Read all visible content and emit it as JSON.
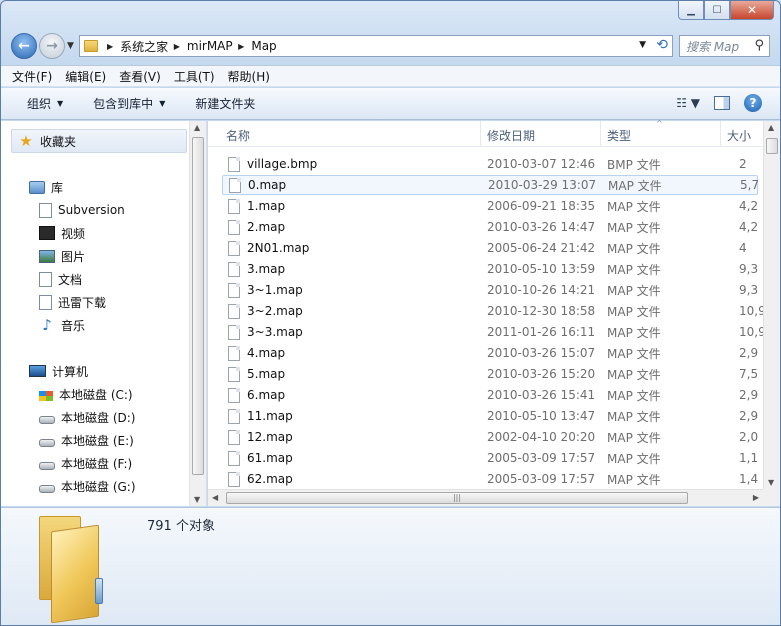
{
  "window": {
    "caption_buttons": [
      "minimize",
      "maximize",
      "close"
    ]
  },
  "address": {
    "crumbs": [
      "系统之家",
      "mirMAP",
      "Map"
    ]
  },
  "search": {
    "placeholder": "搜索 Map"
  },
  "menu": [
    "文件(F)",
    "编辑(E)",
    "查看(V)",
    "工具(T)",
    "帮助(H)"
  ],
  "commands": {
    "organize": "组织",
    "include_library": "包含到库中",
    "new_folder": "新建文件夹"
  },
  "nav": {
    "favorites": "收藏夹",
    "libraries": "库",
    "library_items": [
      "Subversion",
      "视频",
      "图片",
      "文档",
      "迅雷下载",
      "音乐"
    ],
    "computer": "计算机",
    "drives": [
      "本地磁盘 (C:)",
      "本地磁盘 (D:)",
      "本地磁盘 (E:)",
      "本地磁盘 (F:)",
      "本地磁盘 (G:)"
    ]
  },
  "columns": {
    "name": "名称",
    "modified": "修改日期",
    "type": "类型",
    "size": "大小"
  },
  "files": [
    {
      "name": "village.bmp",
      "modified": "2010-03-07 12:46",
      "type": "BMP 文件",
      "size": "2"
    },
    {
      "name": "0.map",
      "modified": "2010-03-29 13:07",
      "type": "MAP 文件",
      "size": "5,7"
    },
    {
      "name": "1.map",
      "modified": "2006-09-21 18:35",
      "type": "MAP 文件",
      "size": "4,2"
    },
    {
      "name": "2.map",
      "modified": "2010-03-26 14:47",
      "type": "MAP 文件",
      "size": "4,2"
    },
    {
      "name": "2N01.map",
      "modified": "2005-06-24 21:42",
      "type": "MAP 文件",
      "size": "4"
    },
    {
      "name": "3.map",
      "modified": "2010-05-10 13:59",
      "type": "MAP 文件",
      "size": "9,3"
    },
    {
      "name": "3~1.map",
      "modified": "2010-10-26 14:21",
      "type": "MAP 文件",
      "size": "9,3"
    },
    {
      "name": "3~2.map",
      "modified": "2010-12-30 18:58",
      "type": "MAP 文件",
      "size": "10,9"
    },
    {
      "name": "3~3.map",
      "modified": "2011-01-26 16:11",
      "type": "MAP 文件",
      "size": "10,9"
    },
    {
      "name": "4.map",
      "modified": "2010-03-26 15:07",
      "type": "MAP 文件",
      "size": "2,9"
    },
    {
      "name": "5.map",
      "modified": "2010-03-26 15:20",
      "type": "MAP 文件",
      "size": "7,5"
    },
    {
      "name": "6.map",
      "modified": "2010-03-26 15:41",
      "type": "MAP 文件",
      "size": "2,9"
    },
    {
      "name": "11.map",
      "modified": "2010-05-10 13:47",
      "type": "MAP 文件",
      "size": "2,9"
    },
    {
      "name": "12.map",
      "modified": "2002-04-10 20:20",
      "type": "MAP 文件",
      "size": "2,0"
    },
    {
      "name": "61.map",
      "modified": "2005-03-09 17:57",
      "type": "MAP 文件",
      "size": "1,1"
    },
    {
      "name": "62.map",
      "modified": "2005-03-09 17:57",
      "type": "MAP 文件",
      "size": "1,4"
    }
  ],
  "selected_file": "0.map",
  "status": {
    "count": "791 个对象"
  },
  "colors": {
    "selection_border": "#b8d3f0",
    "folder": "#f0c759",
    "accent": "#2a67b5"
  }
}
